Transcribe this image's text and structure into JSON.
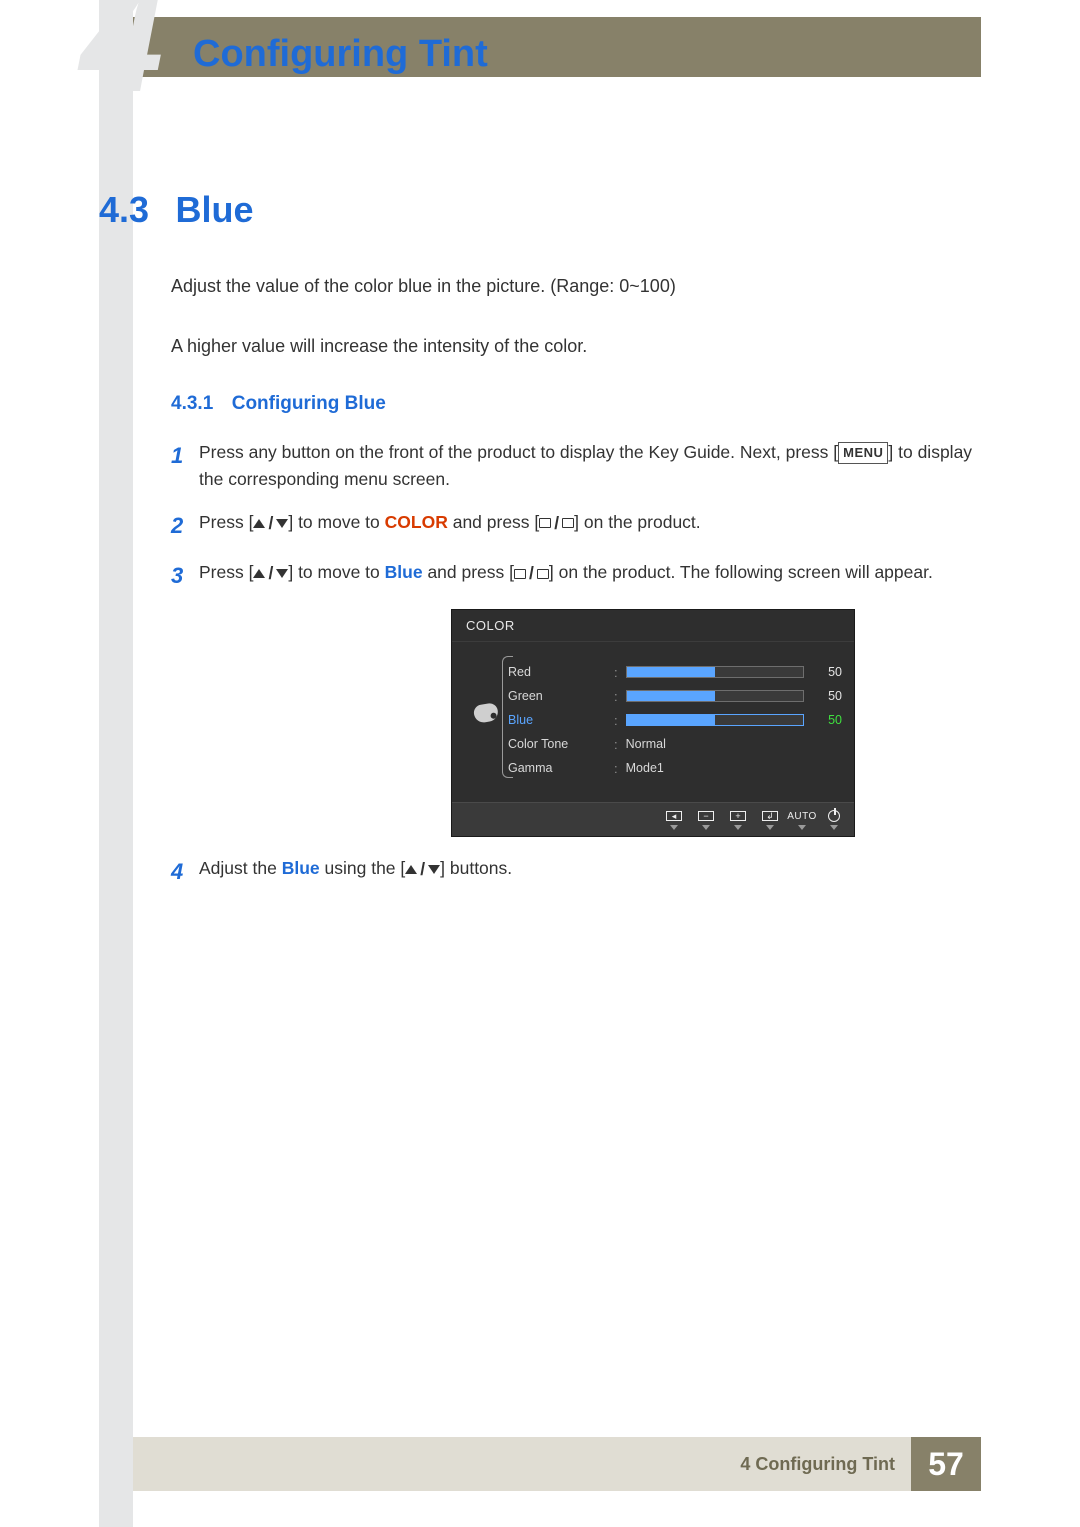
{
  "chapter": {
    "big_number": "4",
    "title": "Configuring Tint"
  },
  "section": {
    "number": "4.3",
    "title": "Blue",
    "para1": "Adjust the value of the color blue in the picture. (Range: 0~100)",
    "para2": "A higher value will increase the intensity of the color."
  },
  "subsection": {
    "number": "4.3.1",
    "title": "Configuring Blue"
  },
  "steps": [
    {
      "n": "1",
      "pre": "Press any button on the front of the product to display the Key Guide. Next, press [",
      "menu": "MENU",
      "post": "] to display the corresponding menu screen."
    },
    {
      "n": "2",
      "pre": "Press [",
      "mid1": "] to move to ",
      "hl": "COLOR",
      "mid2": " and press [",
      "post": "] on the product."
    },
    {
      "n": "3",
      "pre": "Press [",
      "mid1": "] to move to ",
      "hl": "Blue",
      "mid2": " and press [",
      "post": "] on the product. The following screen will appear."
    },
    {
      "n": "4",
      "pre": "Adjust the ",
      "hl": "Blue",
      "mid": " using the [",
      "post": "] buttons."
    }
  ],
  "osd": {
    "header": "COLOR",
    "items": {
      "red": {
        "label": "Red",
        "value": "50"
      },
      "green": {
        "label": "Green",
        "value": "50"
      },
      "blue": {
        "label": "Blue",
        "value": "50"
      },
      "color_tone": {
        "label": "Color Tone",
        "value": "Normal"
      },
      "gamma": {
        "label": "Gamma",
        "value": "Mode1"
      }
    },
    "footer": {
      "auto": "AUTO"
    }
  },
  "footer": {
    "chapter_ref": "4 Configuring Tint",
    "page": "57"
  }
}
